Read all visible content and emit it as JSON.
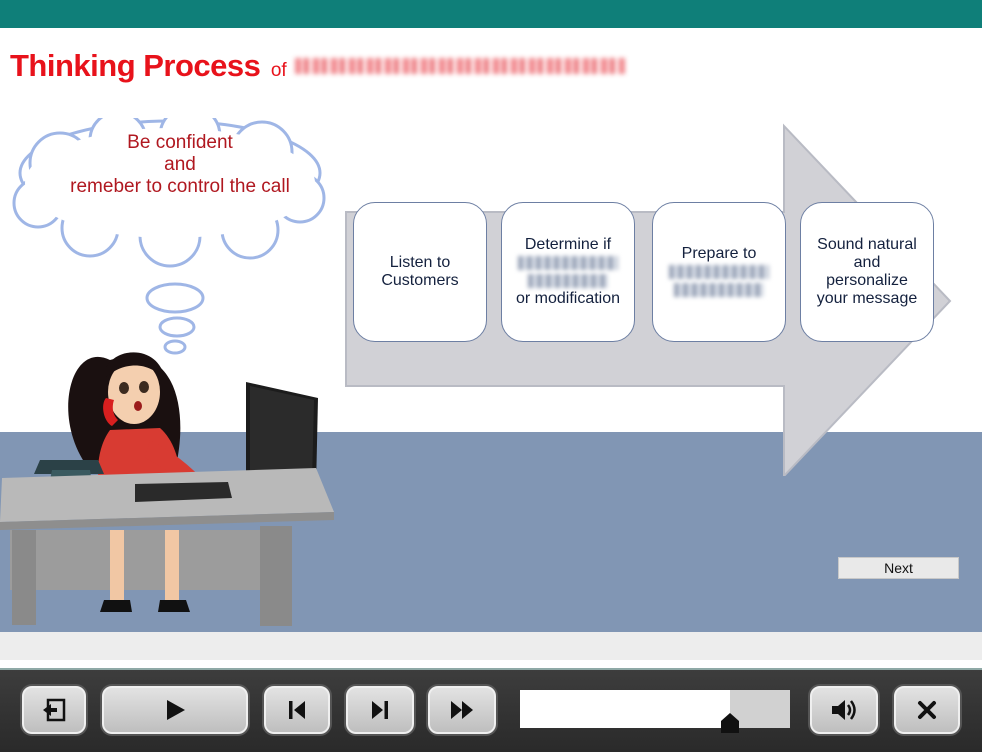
{
  "slide": {
    "title_main": "Thinking Process",
    "title_of": "of",
    "thought": {
      "line1": "Be confident",
      "line2": "and",
      "line3": "remeber to control the call"
    },
    "steps": [
      {
        "text": "Listen to Customers"
      },
      {
        "line1": "Determine if",
        "line3": "or modification"
      },
      {
        "line1": "Prepare to"
      },
      {
        "text": "Sound natural and personalize your message"
      }
    ],
    "next_label": "Next"
  },
  "player": {
    "progress": 0.78,
    "buttons": [
      "exit-icon",
      "play-icon",
      "skip-back-icon",
      "skip-next-icon",
      "fast-forward-icon",
      "volume-icon",
      "close-icon"
    ]
  },
  "colors": {
    "top_bar": "#0f7f79",
    "title": "#e8121b",
    "thought_text": "#b01820",
    "floor": "#8196b4",
    "arrow": "#d1d1d6"
  }
}
